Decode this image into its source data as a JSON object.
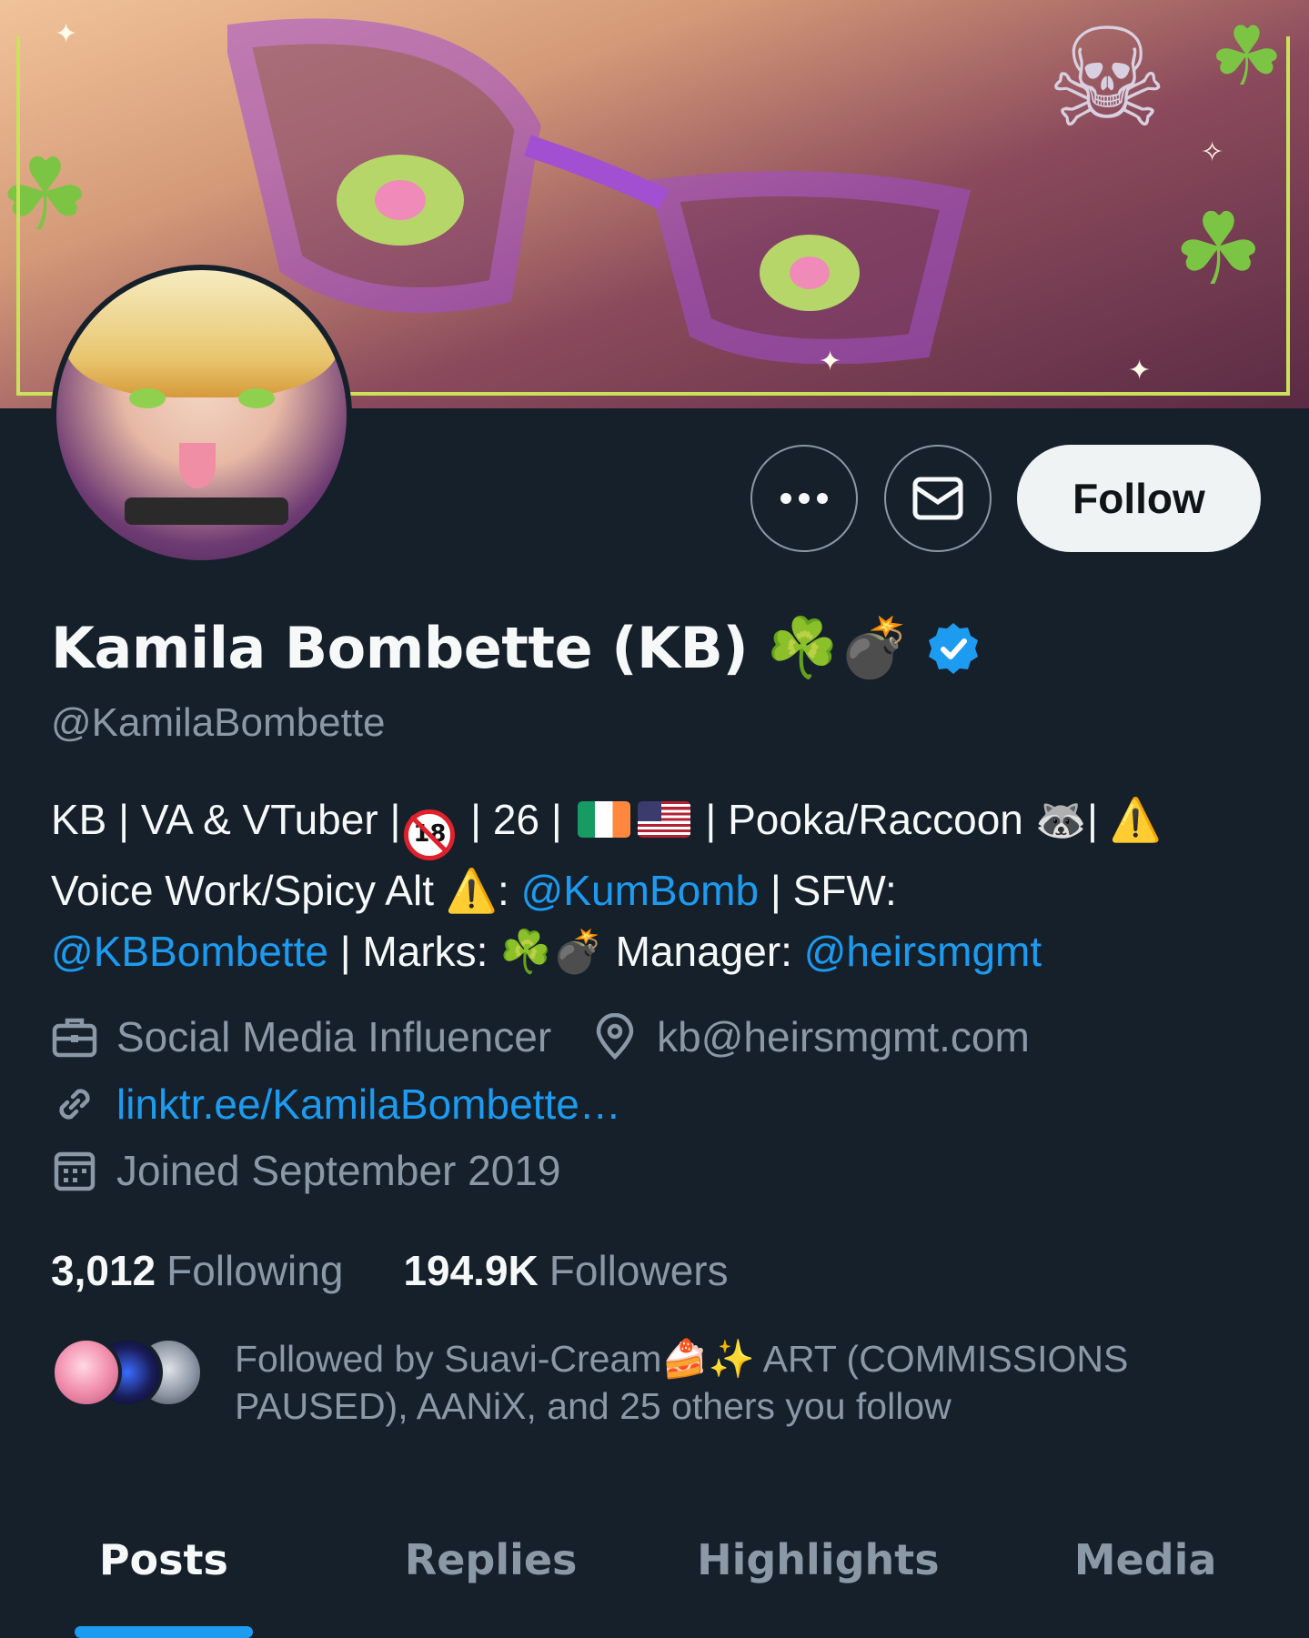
{
  "header": {
    "follow_label": "Follow"
  },
  "profile": {
    "display_name": "Kamila Bombette (KB)",
    "name_emoji": "☘️💣",
    "handle": "@KamilaBombette"
  },
  "bio": {
    "line1_a": "KB | VA & VTuber |",
    "line1_18": "18",
    "line1_b": " | 26 | ",
    "line1_c": " | Pooka/Raccoon ",
    "line1_raccoon": "🦝",
    "line1_d": "| ",
    "warn": "⚠️",
    "line2_a": "Voice Work/Spicy Alt ",
    "line2_b": ": ",
    "mention_spicy": "@KumBomb",
    "line2_c": " | SFW:",
    "mention_sfw": "@KBBombette",
    "line3_a": " | Marks: ",
    "marks_clover": "☘️",
    "marks_bomb": "💣",
    "line3_b": " Manager: ",
    "mention_manager": "@heirsmgmt"
  },
  "meta": {
    "category": "Social Media Influencer",
    "location": "kb@heirsmgmt.com",
    "website": "linktr.ee/KamilaBombette…",
    "joined": "Joined September 2019"
  },
  "stats": {
    "following_count": "3,012",
    "following_label": "Following",
    "followers_count": "194.9K",
    "followers_label": "Followers"
  },
  "followed_by": {
    "text": "Followed by Suavi-Cream🍰✨ ART (COMMISSIONS PAUSED), AANiX, and 25 others you follow"
  },
  "tabs": [
    {
      "label": "Posts",
      "active": true
    },
    {
      "label": "Replies",
      "active": false
    },
    {
      "label": "Highlights",
      "active": false
    },
    {
      "label": "Media",
      "active": false
    }
  ],
  "colors": {
    "background": "#15202b",
    "accent": "#1d9bf0",
    "muted": "#8b98a5",
    "text": "#f7f9f9"
  },
  "icons": {
    "more": "more-horizontal-icon",
    "message": "envelope-icon",
    "verified": "verified-badge-icon",
    "category": "briefcase-icon",
    "location": "location-pin-icon",
    "link": "link-icon",
    "joined": "calendar-icon"
  }
}
